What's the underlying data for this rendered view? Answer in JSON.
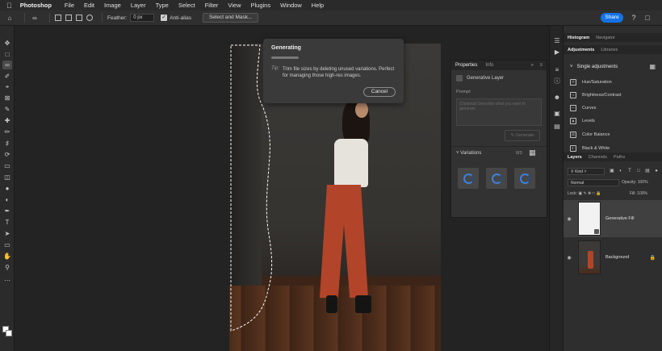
{
  "menubar": {
    "app_name": "Photoshop",
    "items": [
      "File",
      "Edit",
      "Image",
      "Layer",
      "Type",
      "Select",
      "Filter",
      "View",
      "Plugins",
      "Window",
      "Help"
    ]
  },
  "options": {
    "feather_label": "Feather:",
    "feather_value": "0 px",
    "antialias_label": "Anti-alias",
    "select_mask_label": "Select and Mask...",
    "share_label": "Share"
  },
  "dialog": {
    "title": "Generating",
    "tip_label": "Tip:",
    "tip_text": "Trim file sizes by deleting unused variations. Perfect for managing those high-res images.",
    "cancel_label": "Cancel"
  },
  "properties": {
    "tabs": [
      "Properties",
      "Info"
    ],
    "layer_name": "Generative Layer",
    "prompt_label": "Prompt",
    "prompt_placeholder": "(Optional) Describe what you want to generate",
    "generate_label": "Generate",
    "variations_label": "Variations",
    "variations_count": "0/3"
  },
  "right_panel": {
    "top_tabs": [
      "Histogram",
      "Navigator"
    ],
    "adj_tabs": [
      "Adjustments",
      "Libraries"
    ],
    "single_adjustments": "Single adjustments",
    "adjustments": [
      "Hue/Saturation",
      "Brightness/Contrast",
      "Curves",
      "Levels",
      "Color Balance",
      "Black & White"
    ],
    "layer_tabs": [
      "Layers",
      "Channels",
      "Paths"
    ],
    "kind_label": "Kind",
    "blend_mode": "Normal",
    "opacity_label": "Opacity:",
    "opacity_value": "100%",
    "lock_label": "Lock:",
    "fill_label": "Fill:",
    "fill_value": "100%",
    "layers": [
      {
        "name": "Generative Fill"
      },
      {
        "name": "Background"
      }
    ]
  },
  "colors": {
    "accent": "#1473e6",
    "spinner": "#3f7fd8",
    "pants": "#b2442a"
  }
}
